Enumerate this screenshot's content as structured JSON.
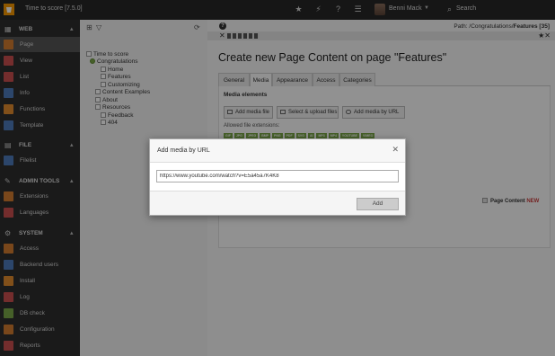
{
  "topbar": {
    "app_title": "Time to score [7.5.0]",
    "user_name": "Benni Mack",
    "search_label": "Search",
    "icons": [
      "star-icon",
      "bolt-icon",
      "help-icon",
      "list-icon"
    ]
  },
  "module_menu": {
    "groups": [
      {
        "label": "WEB",
        "icon": "globe-icon",
        "items": [
          {
            "label": "Page",
            "color": "#d07b2f"
          },
          {
            "label": "View",
            "color": "#c94f4f"
          },
          {
            "label": "List",
            "color": "#c94f4f"
          },
          {
            "label": "Info",
            "color": "#4d79b8"
          },
          {
            "label": "Functions",
            "color": "#e08a2d"
          },
          {
            "label": "Template",
            "color": "#4d79b8"
          }
        ]
      },
      {
        "label": "FILE",
        "icon": "folder-icon",
        "items": [
          {
            "label": "Filelist",
            "color": "#4d79b8"
          }
        ]
      },
      {
        "label": "ADMIN TOOLS",
        "icon": "wrench-icon",
        "items": [
          {
            "label": "Extensions",
            "color": "#d07b2f"
          },
          {
            "label": "Languages",
            "color": "#c94f4f"
          }
        ]
      },
      {
        "label": "SYSTEM",
        "icon": "gear-icon",
        "items": [
          {
            "label": "Access",
            "color": "#d07b2f"
          },
          {
            "label": "Backend users",
            "color": "#4d79b8"
          },
          {
            "label": "Install",
            "color": "#e08a2d"
          },
          {
            "label": "Log",
            "color": "#c94f4f"
          },
          {
            "label": "DB check",
            "color": "#79a548"
          },
          {
            "label": "Configuration",
            "color": "#d07b2f"
          },
          {
            "label": "Reports",
            "color": "#c94f4f"
          }
        ]
      }
    ]
  },
  "tree": {
    "root": "Time to score",
    "nodes": [
      "Congratulations",
      "Home",
      "Features",
      "Customizing",
      "Content Examples",
      "About",
      "Resources",
      "Feedback",
      "404"
    ]
  },
  "content": {
    "path_prefix": "Path: /Congratulations/",
    "path_page": "Features [35]",
    "title": "Create new Page Content on page \"Features\"",
    "tabs": [
      "General",
      "Media",
      "Appearance",
      "Access",
      "Categories"
    ],
    "active_tab": "Media",
    "section_title": "Media elements",
    "buttons": [
      "Add media file",
      "Select & upload files",
      "Add media by URL"
    ],
    "allowed_label": "Allowed file extensions:",
    "extensions": [
      "GIF",
      "JPG",
      "JPEG",
      "BMP",
      "PNG",
      "PDF",
      "SVG",
      "AI",
      "MP3",
      "MP4",
      "YOUTUBE",
      "VIMEO"
    ],
    "page_content_label": "Page Content",
    "new_label": "NEW"
  },
  "modal": {
    "title": "Add media by URL",
    "input_value": "https://www.youtube.com/watch?v=E5a45a7K4K8",
    "add_label": "Add"
  }
}
